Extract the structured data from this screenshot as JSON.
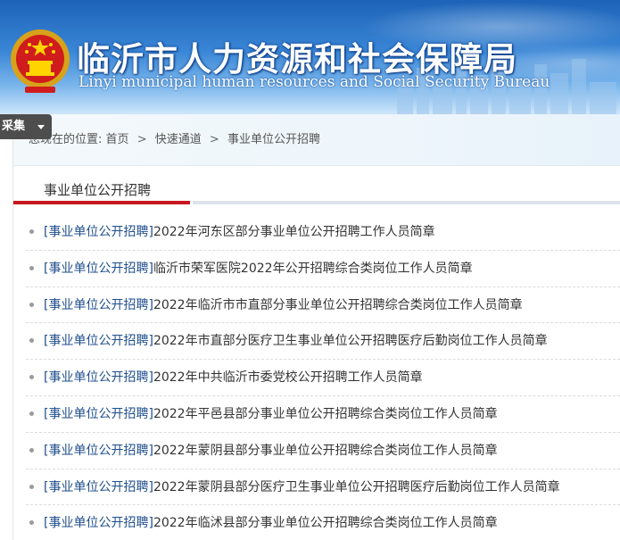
{
  "header": {
    "title": "临沂市人力资源和社会保障局",
    "subtitle": "Linyi municipal human resources and Social Security Bureau"
  },
  "collect_button": {
    "label": "采集"
  },
  "breadcrumb": {
    "prefix": "您现在的位置:",
    "items": [
      "首页",
      "快速通道",
      "事业单位公开招聘"
    ],
    "separator": ">"
  },
  "section": {
    "title": "事业单位公开招聘"
  },
  "news": [
    {
      "tag": "[事业单位公开招聘]",
      "title": "2022年河东区部分事业单位公开招聘工作人员简章"
    },
    {
      "tag": "[事业单位公开招聘]",
      "title": "临沂市荣军医院2022年公开招聘综合类岗位工作人员简章"
    },
    {
      "tag": "[事业单位公开招聘]",
      "title": "2022年临沂市市直部分事业单位公开招聘综合类岗位工作人员简章"
    },
    {
      "tag": "[事业单位公开招聘]",
      "title": "2022年市直部分医疗卫生事业单位公开招聘医疗后勤岗位工作人员简章"
    },
    {
      "tag": "[事业单位公开招聘]",
      "title": "2022年中共临沂市委党校公开招聘工作人员简章"
    },
    {
      "tag": "[事业单位公开招聘]",
      "title": "2022年平邑县部分事业单位公开招聘综合类岗位工作人员简章"
    },
    {
      "tag": "[事业单位公开招聘]",
      "title": "2022年蒙阴县部分事业单位公开招聘综合类岗位工作人员简章"
    },
    {
      "tag": "[事业单位公开招聘]",
      "title": "2022年蒙阴县部分医疗卫生事业单位公开招聘医疗后勤岗位工作人员简章"
    },
    {
      "tag": "[事业单位公开招聘]",
      "title": "2022年临沭县部分事业单位公开招聘综合类岗位工作人员简章"
    }
  ],
  "colors": {
    "banner_blue": "#1d63b8",
    "accent_red": "#c8161d",
    "tag_blue": "#1f4e8c"
  }
}
